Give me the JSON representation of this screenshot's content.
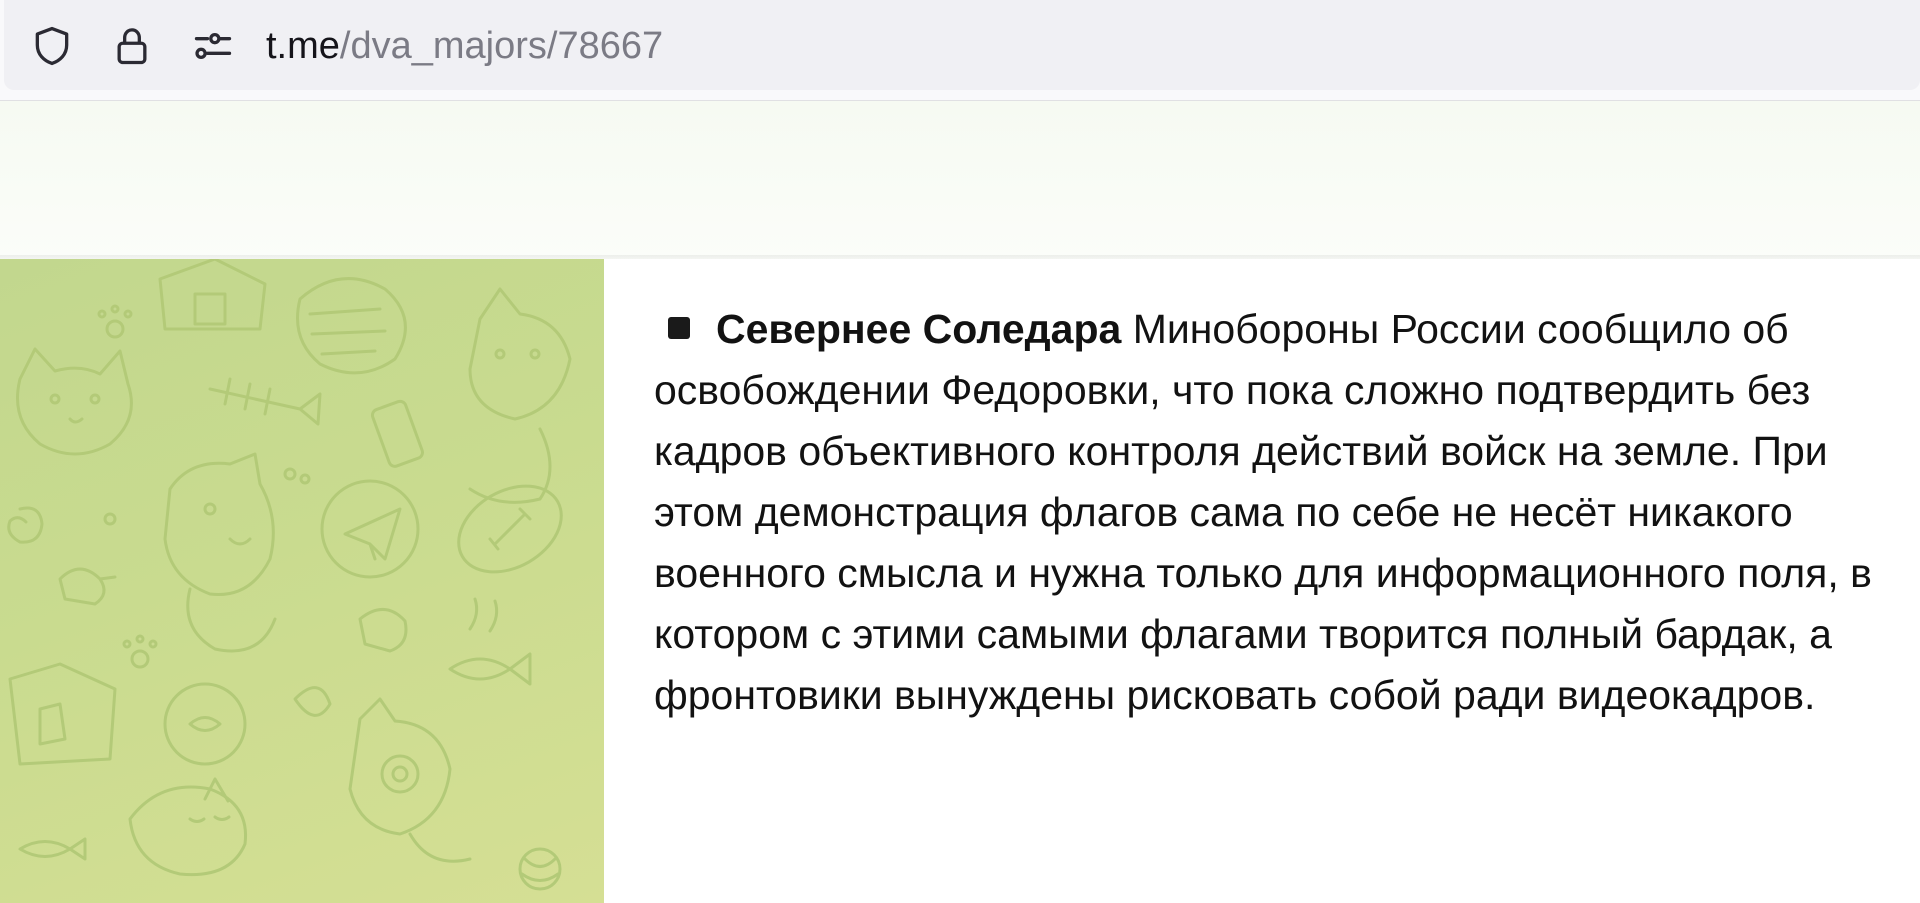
{
  "browser": {
    "url_host": "t.me",
    "url_path": "/dva_majors/78667",
    "icons": [
      "shield-icon",
      "lock-icon",
      "permissions-icon"
    ]
  },
  "message": {
    "bullet_icon": "black-square-icon",
    "bold_lead": "Севернее Соледара",
    "body": " Минобороны России сообщило об освобождении Федоровки, что пока сложно подтвердить без кадров объективного контроля действий войск на земле. При этом демонстрация флагов сама по себе не несёт никакого военного смысла и нужна только для информационного поля, в котором с этими самыми флагами творится полный бардак, а фронтовики вынуждены рисковать собой ради видеокадров."
  },
  "colors": {
    "chat_background": "#c9db8f",
    "pattern_stroke": "#b3ca78",
    "message_background": "#ffffff",
    "urlbar_background": "#f0f0f4"
  }
}
